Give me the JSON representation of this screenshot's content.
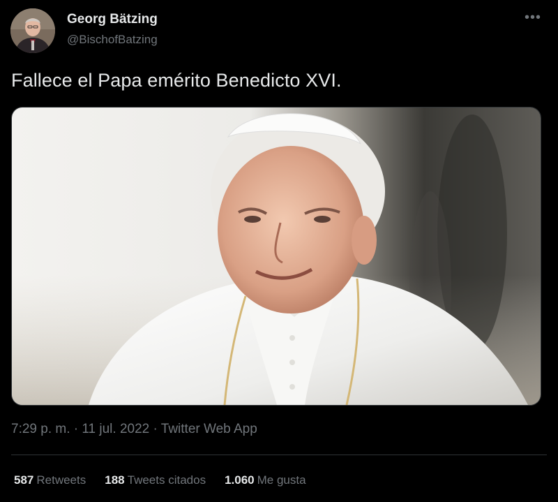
{
  "author": {
    "name": "Georg Bätzing",
    "handle": "@BischofBatzing"
  },
  "more_icon": "more-horizontal-icon",
  "tweet": {
    "text": "Fallece el Papa emérito Benedicto XVI."
  },
  "meta": {
    "time": "7:29 p. m.",
    "separator": " · ",
    "date": "11 jul. 2022",
    "source": "Twitter Web App"
  },
  "stats": {
    "retweets_count": "587",
    "retweets_label": "Retweets",
    "quotes_count": "188",
    "quotes_label": "Tweets citados",
    "likes_count": "1.060",
    "likes_label": "Me gusta"
  },
  "colors": {
    "background": "#000000",
    "text_primary": "#e7e9ea",
    "text_secondary": "#71767b",
    "divider": "#2f3336"
  }
}
